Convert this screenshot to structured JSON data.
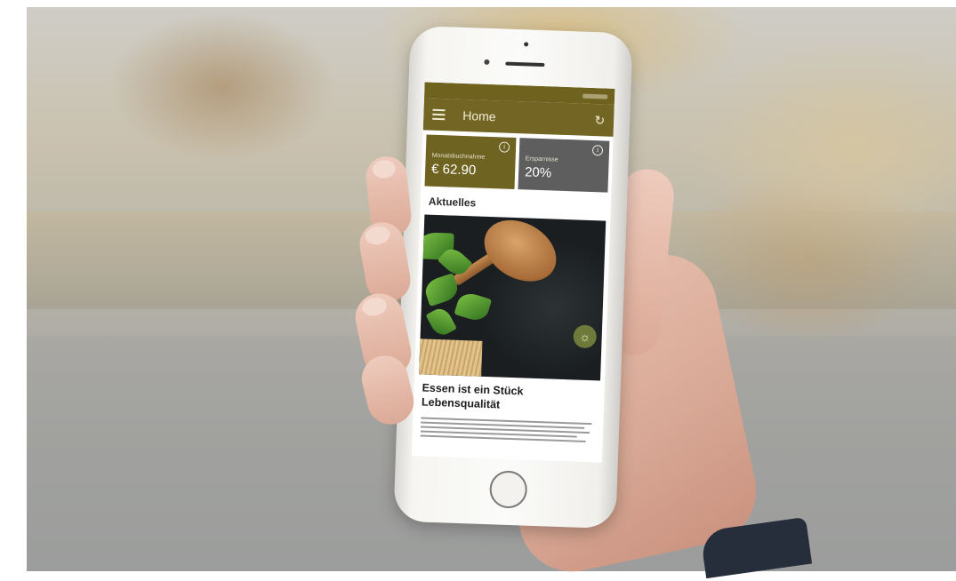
{
  "app": {
    "title": "Home",
    "cards": [
      {
        "label": "Monatsbuchnahme",
        "value": "€ 62.90"
      },
      {
        "label": "Ersparnisse",
        "value": "20%"
      }
    ],
    "section_title": "Aktuelles",
    "article_title": "Essen ist ein Stück Lebensqualität"
  },
  "icons": {
    "menu": "menu-icon",
    "refresh": "refresh-icon",
    "info": "info-icon",
    "bulb": "lightbulb-icon"
  },
  "colors": {
    "app_bar": "#736625",
    "card_primary": "#6e6321",
    "card_secondary": "#5e5e5e"
  }
}
